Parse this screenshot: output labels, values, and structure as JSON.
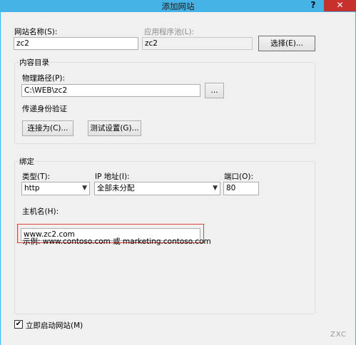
{
  "window": {
    "title": "添加网站",
    "help": "?",
    "close": "✕"
  },
  "site": {
    "name_label": "网站名称(S):",
    "name_value": "zc2",
    "pool_label": "应用程序池(L):",
    "pool_value": "zc2",
    "select_button": "选择(E)..."
  },
  "content": {
    "group_label": "内容目录",
    "path_label": "物理路径(P):",
    "path_value": "C:\\WEB\\zc2",
    "browse_button": "...",
    "auth_label": "传递身份验证",
    "connect_button": "连接为(C)...",
    "test_button": "测试设置(G)..."
  },
  "binding": {
    "group_label": "绑定",
    "type_label": "类型(T):",
    "type_value": "http",
    "ip_label": "IP 地址(I):",
    "ip_value": "全部未分配",
    "port_label": "端口(O):",
    "port_value": "80",
    "host_label": "主机名(H):",
    "host_value": "www.zc2.com",
    "example": "示例: www.contoso.com 或 marketing.contoso.com"
  },
  "start": {
    "label": "立即启动网站(M)",
    "checked": "✔"
  },
  "watermark": "ZXC",
  "colors": {
    "titlebar": "#46b3e6",
    "close": "#c7312b",
    "highlight": "#e0403a"
  }
}
